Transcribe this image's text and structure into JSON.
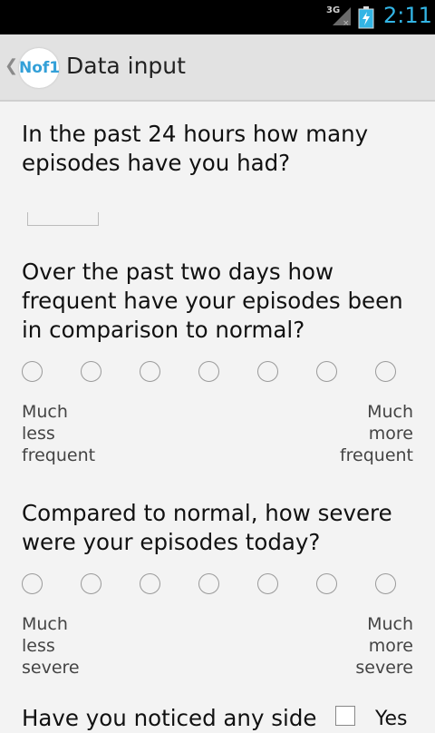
{
  "status_bar": {
    "network": "3G",
    "time": "2:11",
    "colors": {
      "clock": "#33b5e5"
    },
    "icons": [
      "signal-icon",
      "battery-charging-icon"
    ]
  },
  "action_bar": {
    "logo_text": "Nof1",
    "title": "Data input",
    "icons": [
      "up-caret-icon"
    ]
  },
  "questions": [
    {
      "text": "In the past 24 hours how many episodes have you had?",
      "input_value": ""
    },
    {
      "text": "Over the past two days how frequent have your episodes been in comparison to normal?",
      "scale_points": 7,
      "low_label": "Much less frequent",
      "high_label": "Much more frequent"
    },
    {
      "text": "Compared to normal, how severe were your episodes today?",
      "scale_points": 7,
      "low_label": "Much less severe",
      "high_label": "Much more severe"
    },
    {
      "text": "Have you noticed any side",
      "checkbox_label": "Yes"
    }
  ]
}
